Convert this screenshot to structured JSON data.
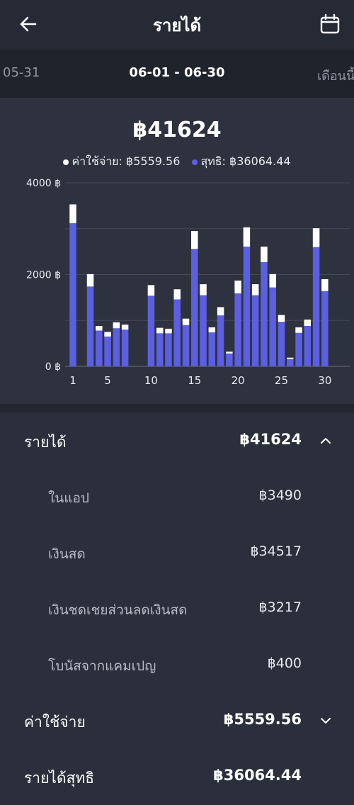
{
  "header": {
    "title": "รายได้"
  },
  "period": {
    "prev": "05-31",
    "current": "06-01 - 06-30",
    "next": "เดือนนี้"
  },
  "summary": {
    "total": "฿41624",
    "legend_expense": "ค่าใช้จ่าย: ฿5559.56",
    "legend_net": "สุทธิ: ฿36064.44"
  },
  "colors": {
    "net": "#5b5fe0",
    "expense": "#ffffff",
    "background": "#2a2f3b"
  },
  "chart_data": {
    "type": "bar",
    "stacked": true,
    "x": [
      1,
      2,
      3,
      4,
      5,
      6,
      7,
      8,
      9,
      10,
      11,
      12,
      13,
      14,
      15,
      16,
      17,
      18,
      19,
      20,
      21,
      22,
      23,
      24,
      25,
      26,
      27,
      28,
      29,
      30
    ],
    "series": [
      {
        "name": "สุทธิ",
        "values": [
          3120,
          0,
          1740,
          780,
          650,
          830,
          800,
          0,
          0,
          1540,
          720,
          720,
          1460,
          900,
          2560,
          1550,
          740,
          1110,
          280,
          1590,
          2610,
          1550,
          2270,
          1720,
          970,
          160,
          730,
          880,
          2600,
          1640
        ]
      },
      {
        "name": "ค่าใช้จ่าย",
        "values": [
          410,
          0,
          270,
          100,
          100,
          130,
          110,
          0,
          0,
          230,
          120,
          100,
          220,
          140,
          390,
          240,
          110,
          180,
          40,
          280,
          420,
          240,
          340,
          290,
          150,
          30,
          120,
          140,
          410,
          260
        ]
      }
    ],
    "y_ticks": [
      "4000 ฿",
      "2000 ฿",
      "0 ฿"
    ],
    "x_ticks": [
      "1",
      "5",
      "10",
      "15",
      "20",
      "25",
      "30"
    ],
    "ylim": [
      0,
      4000
    ],
    "grid": true
  },
  "details": {
    "income": {
      "label": "รายได้",
      "value": "฿41624"
    },
    "in_app": {
      "label": "ในแอป",
      "value": "฿3490"
    },
    "cash": {
      "label": "เงินสด",
      "value": "฿34517"
    },
    "cash_discount": {
      "label": "เงินชดเชยส่วนลดเงินสด",
      "value": "฿3217"
    },
    "bonus": {
      "label": "โบนัสจากแคมเปญ",
      "value": "฿400"
    },
    "expense": {
      "label": "ค่าใช้จ่าย",
      "value": "฿5559.56"
    },
    "net_income": {
      "label": "รายได้สุทธิ",
      "value": "฿36064.44"
    }
  }
}
